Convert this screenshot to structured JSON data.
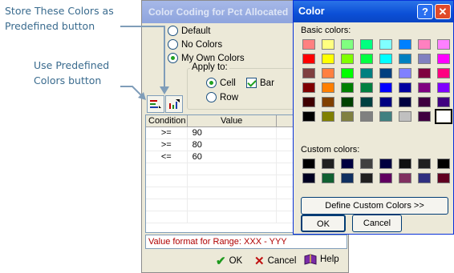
{
  "callouts": {
    "store": "Store These Colors as\nPredefined button",
    "use": "Use Predefined\nColors button"
  },
  "color_coding": {
    "title": "Color Coding for Pct Allocated",
    "options": [
      "Default",
      "No Colors",
      "My Own Colors"
    ],
    "selected_option": "My Own Colors",
    "apply_to_label": "Apply to:",
    "apply_cell": "Cell",
    "apply_bar": "Bar",
    "apply_row": "Row",
    "grid_headers": [
      "Condition",
      "Value",
      ""
    ],
    "rows": [
      {
        "condition": ">=",
        "value": "90"
      },
      {
        "condition": ">=",
        "value": "80"
      },
      {
        "condition": "<=",
        "value": "60"
      }
    ],
    "value_hint": "Value format for Range: XXX - YYY",
    "ok": "OK",
    "cancel": "Cancel",
    "help": "Help"
  },
  "color_dialog": {
    "title": "Color",
    "help_btn": "?",
    "close_btn": "✕",
    "basic_label": "Basic colors:",
    "custom_label": "Custom colors:",
    "define_btn": "Define Custom Colors >>",
    "ok": "OK",
    "cancel": "Cancel",
    "basic_colors": [
      "#ff8080",
      "#ffff80",
      "#80ff80",
      "#00ff80",
      "#80ffff",
      "#0080ff",
      "#ff80c0",
      "#ff80ff",
      "#ff0000",
      "#ffff00",
      "#80ff00",
      "#00ff40",
      "#00ffff",
      "#0080c0",
      "#8080c0",
      "#ff00ff",
      "#804040",
      "#ff8040",
      "#00ff00",
      "#008080",
      "#004080",
      "#8080ff",
      "#800040",
      "#ff0080",
      "#800000",
      "#ff8000",
      "#008000",
      "#008040",
      "#0000ff",
      "#0000a0",
      "#800080",
      "#8000ff",
      "#400000",
      "#804000",
      "#004000",
      "#004040",
      "#000080",
      "#000040",
      "#400040",
      "#400080",
      "#000000",
      "#808000",
      "#808040",
      "#808080",
      "#408080",
      "#c0c0c0",
      "#400040",
      "#ffffff"
    ],
    "selected_basic": 47,
    "custom_colors": [
      "#000000",
      "#202020",
      "#000040",
      "#404040",
      "#000040",
      "#101010",
      "#202020",
      "#000000",
      "#000020",
      "#106030",
      "#103060",
      "#202020",
      "#600060",
      "#803060",
      "#303080",
      "#600020"
    ]
  }
}
